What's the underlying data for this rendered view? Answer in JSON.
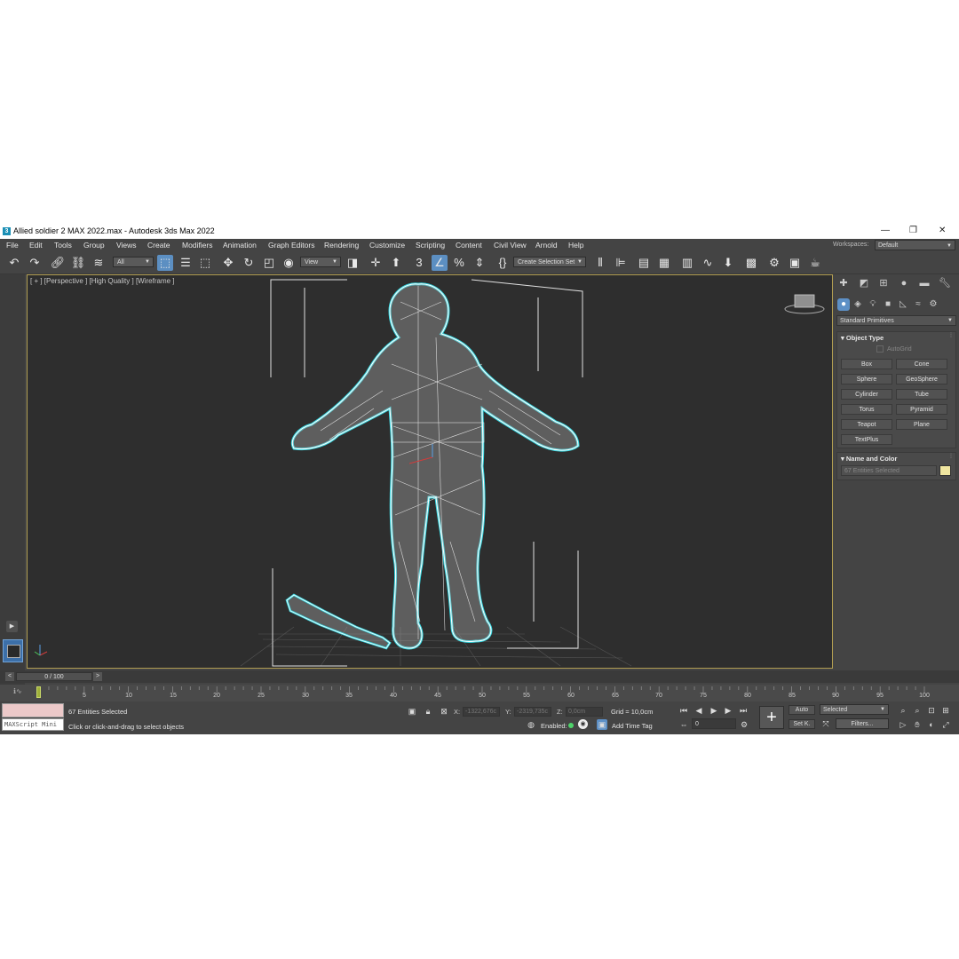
{
  "window": {
    "title": "Allied soldier 2 MAX 2022.max - Autodesk 3ds Max 2022",
    "logo_text": "3",
    "minimize": "—",
    "maximize": "❐",
    "close": "✕"
  },
  "menu": {
    "items": [
      "File",
      "Edit",
      "Tools",
      "Group",
      "Views",
      "Create",
      "Modifiers",
      "Animation",
      "Graph Editors",
      "Rendering",
      "Customize",
      "Scripting",
      "Content",
      "Civil View",
      "Arnold",
      "Help"
    ],
    "workspaces_label": "Workspaces:",
    "workspace_value": "Default"
  },
  "toolbar": {
    "selection_filter": "All",
    "ref_coord": "View",
    "named_selection": "Create Selection Set"
  },
  "viewport": {
    "label": "[ + ] [Perspective ] [High Quality ] [Wireframe ]"
  },
  "command_panel": {
    "category": "Standard Primitives",
    "object_type_title": "Object Type",
    "autogrid_label": "AutoGrid",
    "object_buttons": [
      "Box",
      "Cone",
      "Sphere",
      "GeoSphere",
      "Cylinder",
      "Tube",
      "Torus",
      "Pyramid",
      "Teapot",
      "Plane",
      "TextPlus"
    ],
    "name_color_title": "Name and Color",
    "name_value": "67 Entities Selected",
    "color": "#f0e6a0"
  },
  "time_slider": {
    "label": "0 / 100",
    "left_arrow": "<",
    "right_arrow": ">"
  },
  "trackbar": {
    "ticks": [
      "5",
      "10",
      "15",
      "20",
      "25",
      "30",
      "35",
      "40",
      "45",
      "50",
      "55",
      "60",
      "65",
      "70",
      "75",
      "80",
      "85",
      "90",
      "95",
      "100"
    ],
    "curve_icon": "ℹ∿"
  },
  "status": {
    "maxscript_label": "MAXScript Mini",
    "selected_text": "67 Entities Selected",
    "prompt_text": "Click or click-and-drag to select objects",
    "x_label": "X:",
    "x_value": "-1322,676c",
    "y_label": "Y:",
    "y_value": "-2319,735c",
    "z_label": "Z:",
    "z_value": "0,0cm",
    "grid_text": "Grid = 10,0cm",
    "enabled_label": "Enabled:",
    "add_time_tag": "Add Time Tag",
    "auto_label": "Auto",
    "set_key_label": "Set K.",
    "selected_dd": "Selected",
    "filters_label": "Filters...",
    "frame_value": "0"
  }
}
